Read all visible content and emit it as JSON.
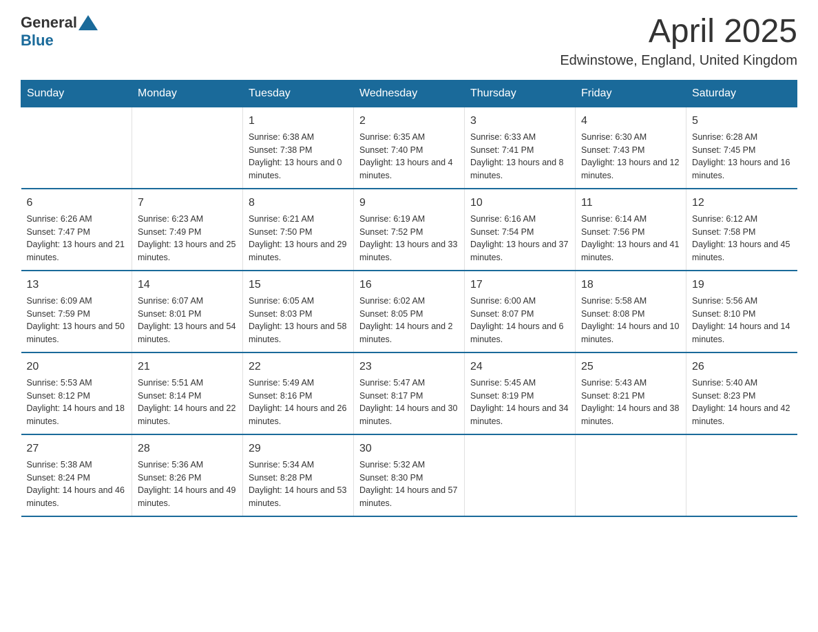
{
  "logo": {
    "text_general": "General",
    "text_blue": "Blue"
  },
  "header": {
    "title": "April 2025",
    "subtitle": "Edwinstowe, England, United Kingdom"
  },
  "days_of_week": [
    "Sunday",
    "Monday",
    "Tuesday",
    "Wednesday",
    "Thursday",
    "Friday",
    "Saturday"
  ],
  "weeks": [
    [
      {
        "day": "",
        "sunrise": "",
        "sunset": "",
        "daylight": ""
      },
      {
        "day": "",
        "sunrise": "",
        "sunset": "",
        "daylight": ""
      },
      {
        "day": "1",
        "sunrise": "Sunrise: 6:38 AM",
        "sunset": "Sunset: 7:38 PM",
        "daylight": "Daylight: 13 hours and 0 minutes."
      },
      {
        "day": "2",
        "sunrise": "Sunrise: 6:35 AM",
        "sunset": "Sunset: 7:40 PM",
        "daylight": "Daylight: 13 hours and 4 minutes."
      },
      {
        "day": "3",
        "sunrise": "Sunrise: 6:33 AM",
        "sunset": "Sunset: 7:41 PM",
        "daylight": "Daylight: 13 hours and 8 minutes."
      },
      {
        "day": "4",
        "sunrise": "Sunrise: 6:30 AM",
        "sunset": "Sunset: 7:43 PM",
        "daylight": "Daylight: 13 hours and 12 minutes."
      },
      {
        "day": "5",
        "sunrise": "Sunrise: 6:28 AM",
        "sunset": "Sunset: 7:45 PM",
        "daylight": "Daylight: 13 hours and 16 minutes."
      }
    ],
    [
      {
        "day": "6",
        "sunrise": "Sunrise: 6:26 AM",
        "sunset": "Sunset: 7:47 PM",
        "daylight": "Daylight: 13 hours and 21 minutes."
      },
      {
        "day": "7",
        "sunrise": "Sunrise: 6:23 AM",
        "sunset": "Sunset: 7:49 PM",
        "daylight": "Daylight: 13 hours and 25 minutes."
      },
      {
        "day": "8",
        "sunrise": "Sunrise: 6:21 AM",
        "sunset": "Sunset: 7:50 PM",
        "daylight": "Daylight: 13 hours and 29 minutes."
      },
      {
        "day": "9",
        "sunrise": "Sunrise: 6:19 AM",
        "sunset": "Sunset: 7:52 PM",
        "daylight": "Daylight: 13 hours and 33 minutes."
      },
      {
        "day": "10",
        "sunrise": "Sunrise: 6:16 AM",
        "sunset": "Sunset: 7:54 PM",
        "daylight": "Daylight: 13 hours and 37 minutes."
      },
      {
        "day": "11",
        "sunrise": "Sunrise: 6:14 AM",
        "sunset": "Sunset: 7:56 PM",
        "daylight": "Daylight: 13 hours and 41 minutes."
      },
      {
        "day": "12",
        "sunrise": "Sunrise: 6:12 AM",
        "sunset": "Sunset: 7:58 PM",
        "daylight": "Daylight: 13 hours and 45 minutes."
      }
    ],
    [
      {
        "day": "13",
        "sunrise": "Sunrise: 6:09 AM",
        "sunset": "Sunset: 7:59 PM",
        "daylight": "Daylight: 13 hours and 50 minutes."
      },
      {
        "day": "14",
        "sunrise": "Sunrise: 6:07 AM",
        "sunset": "Sunset: 8:01 PM",
        "daylight": "Daylight: 13 hours and 54 minutes."
      },
      {
        "day": "15",
        "sunrise": "Sunrise: 6:05 AM",
        "sunset": "Sunset: 8:03 PM",
        "daylight": "Daylight: 13 hours and 58 minutes."
      },
      {
        "day": "16",
        "sunrise": "Sunrise: 6:02 AM",
        "sunset": "Sunset: 8:05 PM",
        "daylight": "Daylight: 14 hours and 2 minutes."
      },
      {
        "day": "17",
        "sunrise": "Sunrise: 6:00 AM",
        "sunset": "Sunset: 8:07 PM",
        "daylight": "Daylight: 14 hours and 6 minutes."
      },
      {
        "day": "18",
        "sunrise": "Sunrise: 5:58 AM",
        "sunset": "Sunset: 8:08 PM",
        "daylight": "Daylight: 14 hours and 10 minutes."
      },
      {
        "day": "19",
        "sunrise": "Sunrise: 5:56 AM",
        "sunset": "Sunset: 8:10 PM",
        "daylight": "Daylight: 14 hours and 14 minutes."
      }
    ],
    [
      {
        "day": "20",
        "sunrise": "Sunrise: 5:53 AM",
        "sunset": "Sunset: 8:12 PM",
        "daylight": "Daylight: 14 hours and 18 minutes."
      },
      {
        "day": "21",
        "sunrise": "Sunrise: 5:51 AM",
        "sunset": "Sunset: 8:14 PM",
        "daylight": "Daylight: 14 hours and 22 minutes."
      },
      {
        "day": "22",
        "sunrise": "Sunrise: 5:49 AM",
        "sunset": "Sunset: 8:16 PM",
        "daylight": "Daylight: 14 hours and 26 minutes."
      },
      {
        "day": "23",
        "sunrise": "Sunrise: 5:47 AM",
        "sunset": "Sunset: 8:17 PM",
        "daylight": "Daylight: 14 hours and 30 minutes."
      },
      {
        "day": "24",
        "sunrise": "Sunrise: 5:45 AM",
        "sunset": "Sunset: 8:19 PM",
        "daylight": "Daylight: 14 hours and 34 minutes."
      },
      {
        "day": "25",
        "sunrise": "Sunrise: 5:43 AM",
        "sunset": "Sunset: 8:21 PM",
        "daylight": "Daylight: 14 hours and 38 minutes."
      },
      {
        "day": "26",
        "sunrise": "Sunrise: 5:40 AM",
        "sunset": "Sunset: 8:23 PM",
        "daylight": "Daylight: 14 hours and 42 minutes."
      }
    ],
    [
      {
        "day": "27",
        "sunrise": "Sunrise: 5:38 AM",
        "sunset": "Sunset: 8:24 PM",
        "daylight": "Daylight: 14 hours and 46 minutes."
      },
      {
        "day": "28",
        "sunrise": "Sunrise: 5:36 AM",
        "sunset": "Sunset: 8:26 PM",
        "daylight": "Daylight: 14 hours and 49 minutes."
      },
      {
        "day": "29",
        "sunrise": "Sunrise: 5:34 AM",
        "sunset": "Sunset: 8:28 PM",
        "daylight": "Daylight: 14 hours and 53 minutes."
      },
      {
        "day": "30",
        "sunrise": "Sunrise: 5:32 AM",
        "sunset": "Sunset: 8:30 PM",
        "daylight": "Daylight: 14 hours and 57 minutes."
      },
      {
        "day": "",
        "sunrise": "",
        "sunset": "",
        "daylight": ""
      },
      {
        "day": "",
        "sunrise": "",
        "sunset": "",
        "daylight": ""
      },
      {
        "day": "",
        "sunrise": "",
        "sunset": "",
        "daylight": ""
      }
    ]
  ]
}
